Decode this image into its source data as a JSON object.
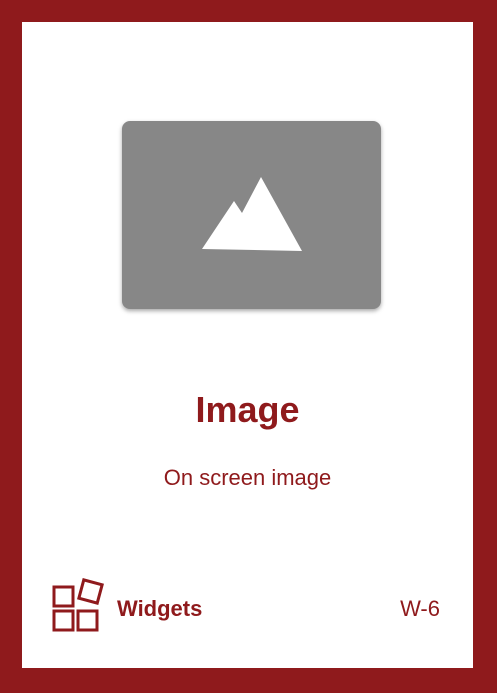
{
  "card": {
    "title": "Image",
    "subtitle": "On screen image",
    "category": "Widgets",
    "code": "W-6",
    "icon": "mountain-image-icon",
    "category_icon": "widgets-icon"
  },
  "colors": {
    "accent": "#8f1a1c",
    "placeholder": "#878787",
    "background": "#ffffff"
  }
}
